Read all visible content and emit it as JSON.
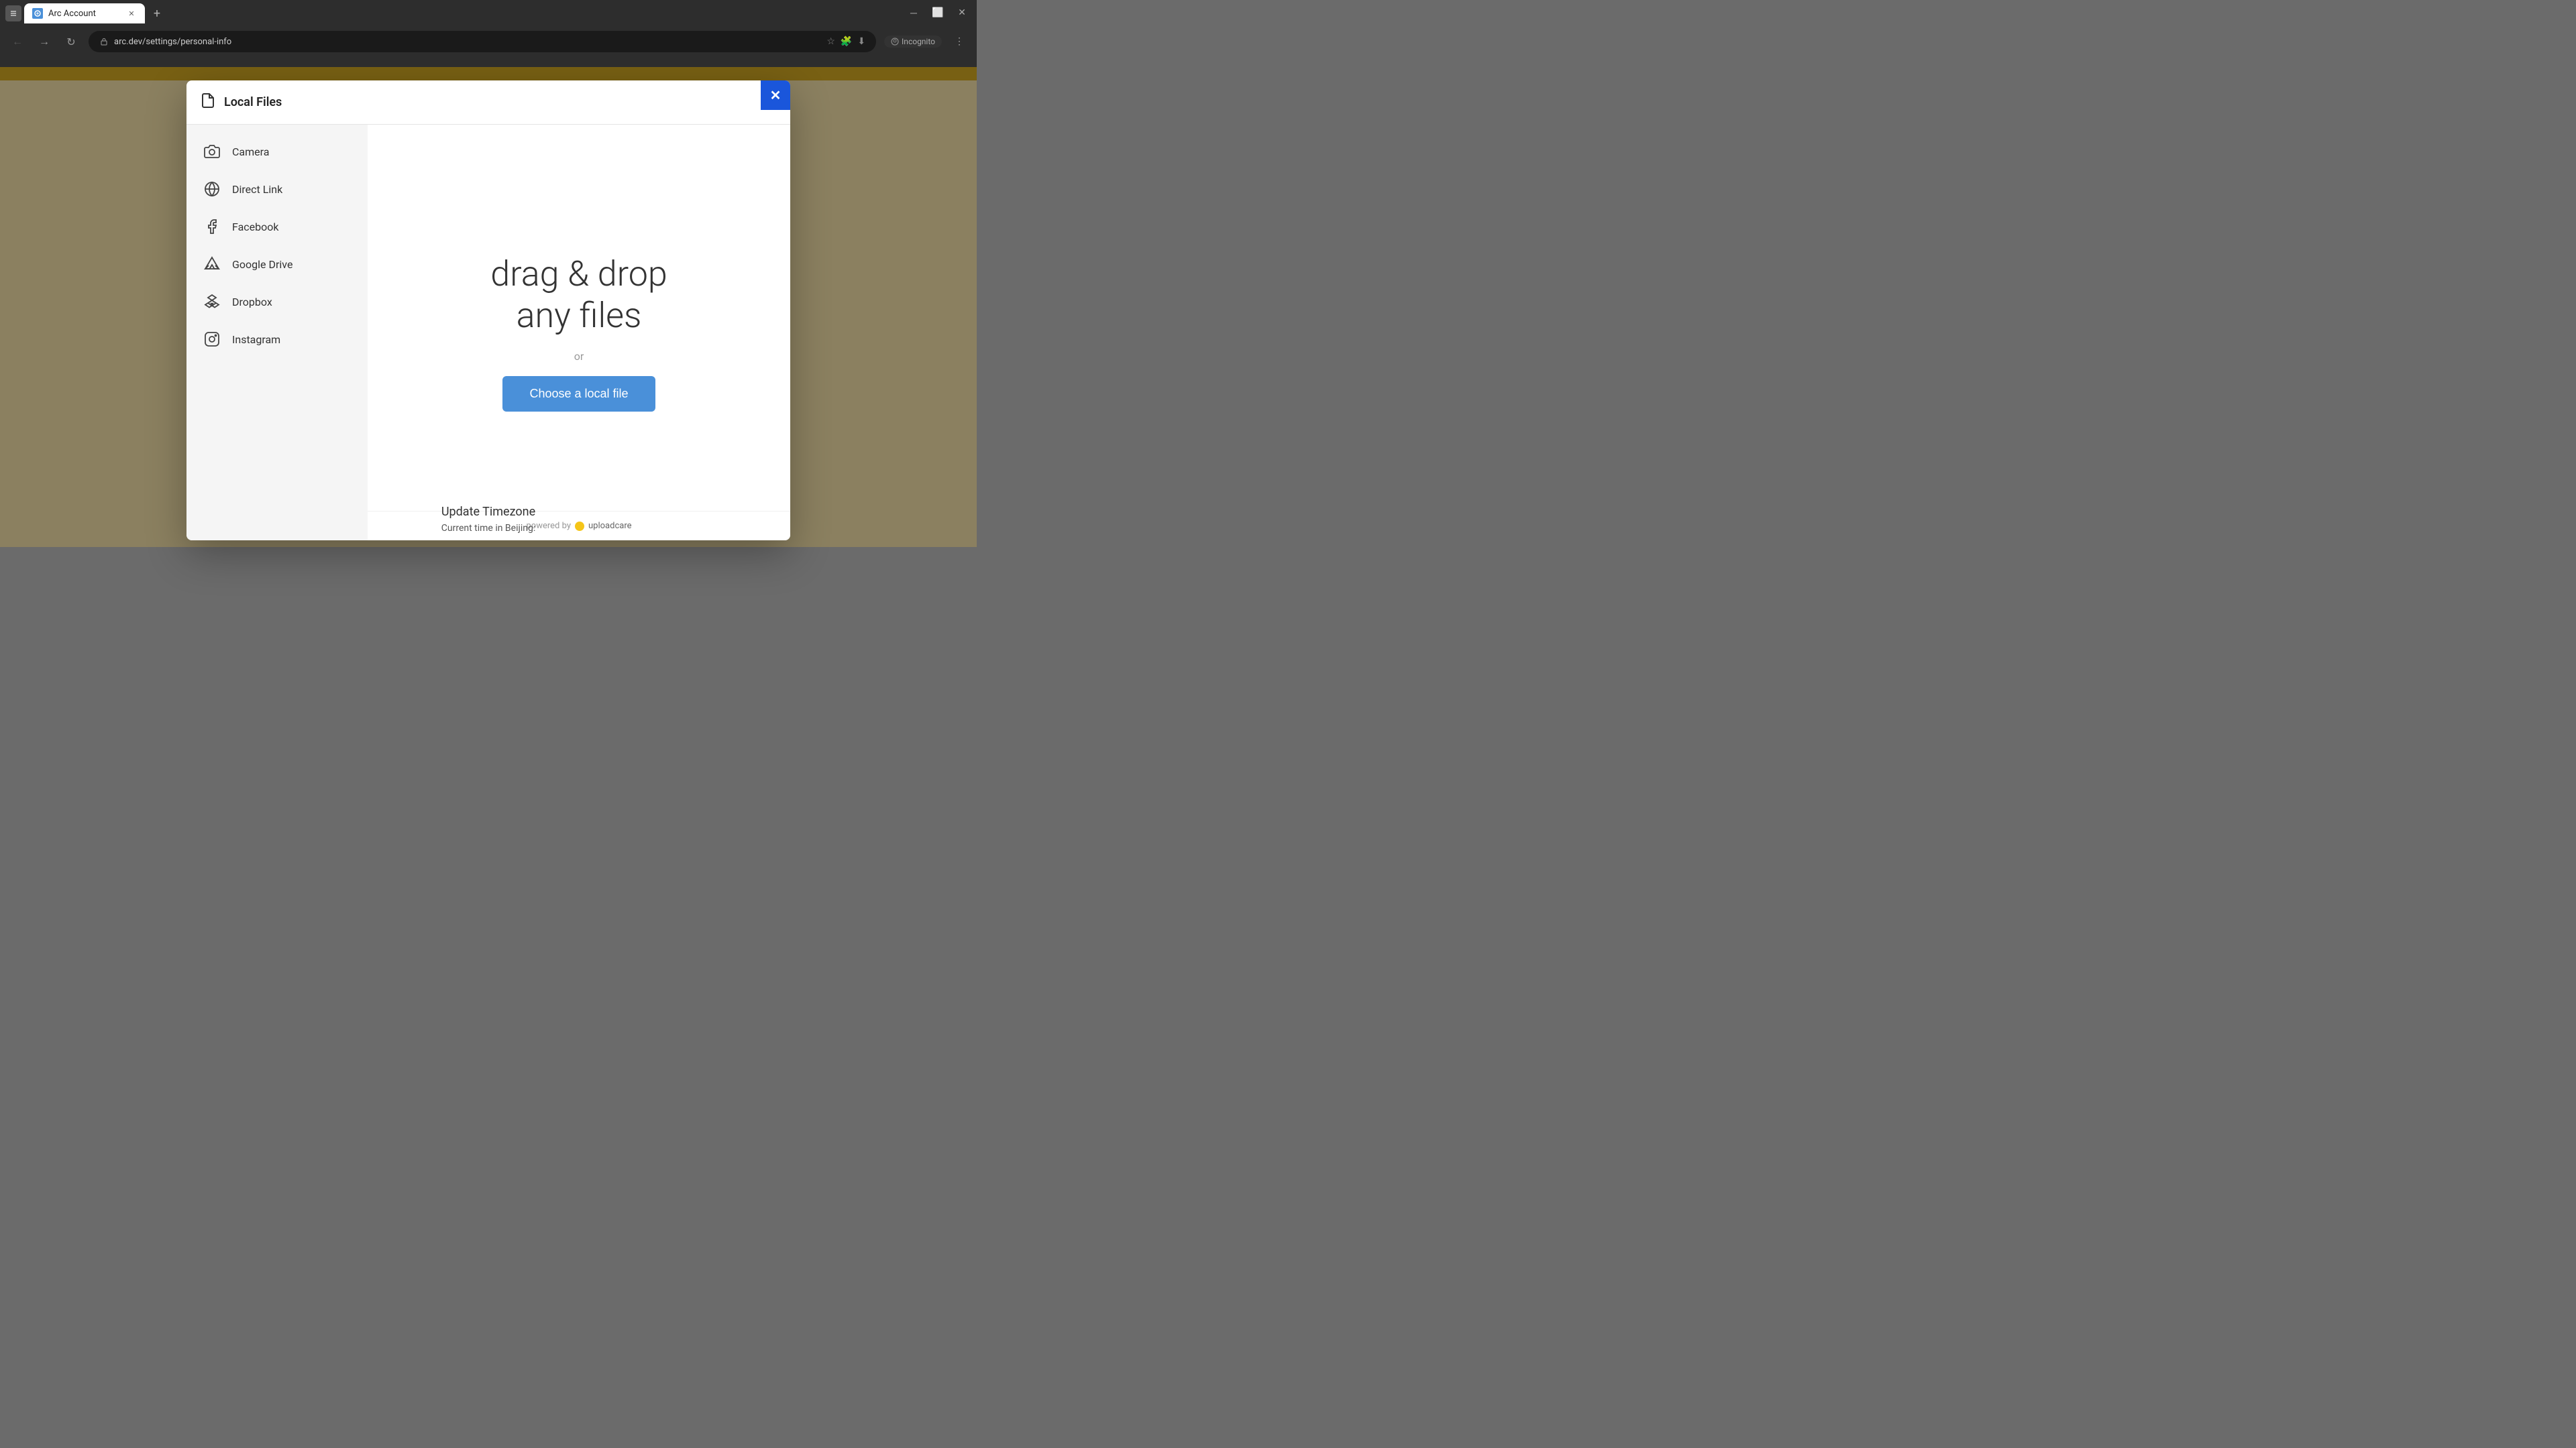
{
  "browser": {
    "tab": {
      "title": "Arc Account",
      "url": "arc.dev/settings/personal-info"
    },
    "incognito_label": "Incognito"
  },
  "modal": {
    "title": "Local Files",
    "close_label": "✕",
    "sidebar": {
      "items": [
        {
          "id": "camera",
          "label": "Camera",
          "icon": "camera"
        },
        {
          "id": "direct-link",
          "label": "Direct Link",
          "icon": "link"
        },
        {
          "id": "facebook",
          "label": "Facebook",
          "icon": "facebook"
        },
        {
          "id": "google-drive",
          "label": "Google Drive",
          "icon": "google-drive"
        },
        {
          "id": "dropbox",
          "label": "Dropbox",
          "icon": "dropbox"
        },
        {
          "id": "instagram",
          "label": "Instagram",
          "icon": "instagram"
        }
      ]
    },
    "main": {
      "drag_drop_text": "drag & drop\nany files",
      "or_text": "or",
      "choose_file_label": "Choose a local file"
    },
    "footer": {
      "powered_by": "powered by",
      "brand": "uploadcare"
    }
  },
  "page": {
    "update_timezone_label": "Update Timezone",
    "current_time_label": "Current time in Beijing:"
  }
}
